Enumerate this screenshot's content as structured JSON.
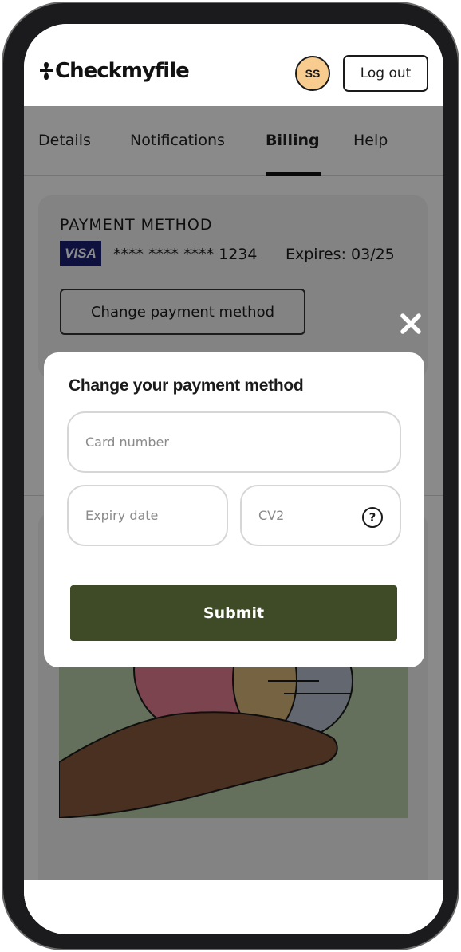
{
  "colors": {
    "accent": "#3f4a26",
    "avatar_bg": "#f8cc8e",
    "visa_blue": "#1a1f71",
    "illustration_bg": "#b9ceaa"
  },
  "header": {
    "logo_text": "Checkmyfile",
    "avatar_initials": "SS",
    "logout_label": "Log out"
  },
  "tabs": [
    {
      "label": "Details"
    },
    {
      "label": "Notifications"
    },
    {
      "label": "Billing",
      "active": true
    },
    {
      "label": "Help"
    }
  ],
  "payment": {
    "title": "PAYMENT METHOD",
    "brand": "VISA",
    "masked_number": "**** **** **** 1234",
    "expiry": "Expires: 03/25",
    "change_button": "Change payment method"
  },
  "modal": {
    "title": "Change your payment method",
    "card_number_placeholder": "Card number",
    "expiry_placeholder": "Expiry date",
    "cv2_placeholder": "CV2",
    "help_glyph": "?",
    "submit_label": "Submit",
    "close_icon": "close-icon"
  }
}
